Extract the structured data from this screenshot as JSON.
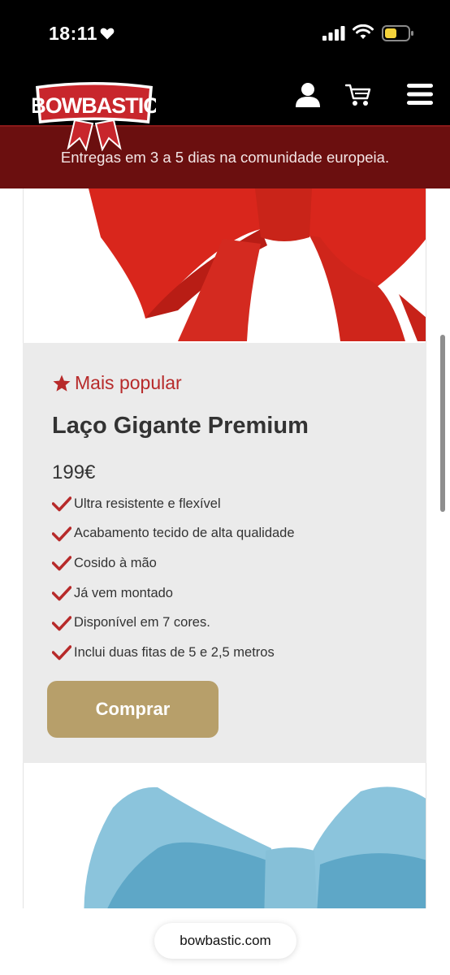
{
  "status_bar": {
    "time": "18:11",
    "heart_icon": "heart-icon",
    "signal_icon": "cellular-signal-icon",
    "wifi_icon": "wifi-icon",
    "battery_icon": "battery-icon",
    "battery_color": "#f5d33b"
  },
  "header": {
    "logo_text": "BOWBASTIC",
    "icons": [
      "user-icon",
      "cart-icon",
      "hamburger-menu-icon"
    ],
    "background": "#000000"
  },
  "promo_banner": {
    "text": "Entregas em 3 a 5 dias na comunidade europeia.",
    "background": "#6b0f0f"
  },
  "product": {
    "badge_icon": "star-icon",
    "badge_label": "Mais popular",
    "title": "Laço Gigante Premium",
    "price": "199€",
    "features": [
      "Ultra resistente e flexível",
      "Acabamento tecido de alta qualidade",
      "Cosido à mão",
      "Já vem montado",
      "Disponível em 7 cores.",
      "Inclui duas fitas de 5 e 2,5 metros"
    ],
    "feature_icon": "checkmark-icon",
    "buy_label": "Comprar",
    "accent_color": "#b72a2a",
    "button_color": "#b79f6a"
  },
  "next_product": {
    "image_icon": "blue-bow-image"
  },
  "browser": {
    "url": "bowbastic.com"
  }
}
